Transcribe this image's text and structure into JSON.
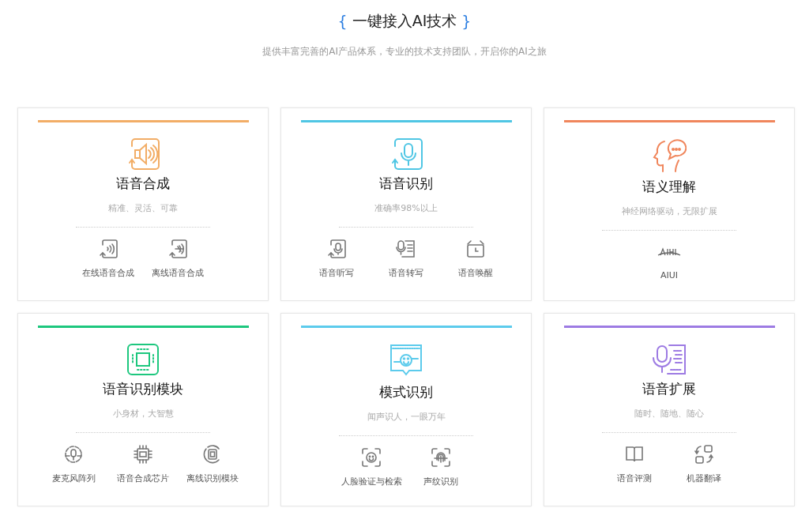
{
  "header": {
    "brace_open": "{",
    "title": "一键接入AI技术",
    "brace_close": "}",
    "subtitle": "提供丰富完善的AI产品体系，专业的技术支持团队，开启你的AI之旅"
  },
  "cards": [
    {
      "title": "语音合成",
      "subtitle": "精准、灵活、可靠",
      "color": "#f2ad66",
      "items": [
        {
          "label": "在线语音合成"
        },
        {
          "label": "离线语音合成"
        }
      ]
    },
    {
      "title": "语音识别",
      "subtitle": "准确率98%以上",
      "color": "#4fc6e4",
      "items": [
        {
          "label": "语音听写"
        },
        {
          "label": "语音转写"
        },
        {
          "label": "语音唤醒"
        }
      ]
    },
    {
      "title": "语义理解",
      "subtitle": "神经网络驱动，无限扩展",
      "color": "#f0865c",
      "items": [
        {
          "label": "AIUI"
        }
      ]
    },
    {
      "title": "语音识别模块",
      "subtitle": "小身材，大智慧",
      "color": "#1dc77e",
      "items": [
        {
          "label": "麦克风阵列"
        },
        {
          "label": "语音合成芯片"
        },
        {
          "label": "离线识别模块"
        }
      ]
    },
    {
      "title": "模式识别",
      "subtitle": "闻声识人，一眼万年",
      "color": "#5ccbec",
      "items": [
        {
          "label": "人脸验证与检索"
        },
        {
          "label": "声纹识别"
        }
      ]
    },
    {
      "title": "语音扩展",
      "subtitle": "随时、随地、随心",
      "color": "#9d7be3",
      "items": [
        {
          "label": "语音评测"
        },
        {
          "label": "机器翻译"
        }
      ]
    }
  ]
}
